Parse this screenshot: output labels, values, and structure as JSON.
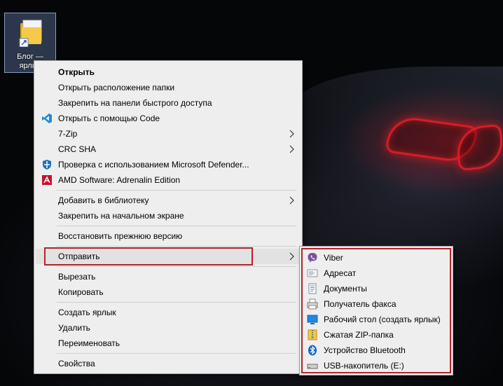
{
  "desktop": {
    "icon_label": "Блог —\nярлык"
  },
  "context_menu": {
    "items": [
      {
        "label": "Открыть"
      },
      {
        "label": "Открыть расположение папки"
      },
      {
        "label": "Закрепить на панели быстрого доступа"
      },
      {
        "label": "Открыть с помощью Code",
        "icon": "vscode-icon"
      },
      {
        "label": "7-Zip"
      },
      {
        "label": "CRC SHA"
      },
      {
        "label": "Проверка с использованием Microsoft Defender...",
        "icon": "defender-icon"
      },
      {
        "label": "AMD Software: Adrenalin Edition",
        "icon": "amd-icon"
      },
      {
        "label": "Добавить в библиотеку"
      },
      {
        "label": "Закрепить на начальном экране"
      },
      {
        "label": "Восстановить прежнюю версию"
      },
      {
        "label": "Отправить"
      },
      {
        "label": "Вырезать"
      },
      {
        "label": "Копировать"
      },
      {
        "label": "Создать ярлык"
      },
      {
        "label": "Удалить"
      },
      {
        "label": "Переименовать"
      },
      {
        "label": "Свойства"
      }
    ]
  },
  "send_to_menu": {
    "items": [
      {
        "label": "Viber",
        "icon": "viber-icon"
      },
      {
        "label": "Адресат",
        "icon": "mail-recipient-icon"
      },
      {
        "label": "Документы",
        "icon": "documents-icon"
      },
      {
        "label": "Получатель факса",
        "icon": "fax-icon"
      },
      {
        "label": "Рабочий стол (создать ярлык)",
        "icon": "desktop-icon"
      },
      {
        "label": "Сжатая ZIP-папка",
        "icon": "zip-folder-icon"
      },
      {
        "label": "Устройство Bluetooth",
        "icon": "bluetooth-icon"
      },
      {
        "label": "USB-накопитель (E:)",
        "icon": "usb-drive-icon"
      }
    ]
  },
  "colors": {
    "highlight_border": "#b0232d",
    "menu_background": "#eeeeee"
  }
}
